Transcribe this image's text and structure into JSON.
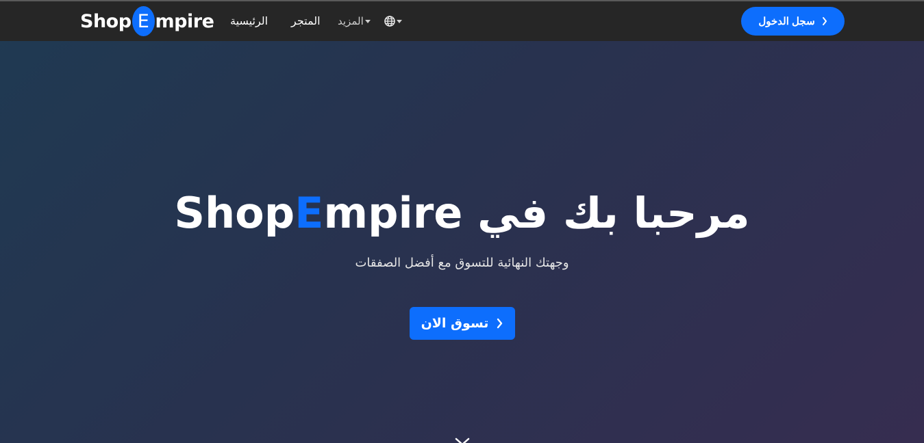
{
  "brand": {
    "part1": "Shop",
    "badge_letter": "E",
    "part2": "mpire"
  },
  "nav": {
    "home": "الرئيسية",
    "store": "المتجر",
    "more": "المزيد",
    "language_icon": "globe-icon"
  },
  "login_button": {
    "label": "سجل الدخول",
    "icon": "chevron-left-icon"
  },
  "hero": {
    "title_arabic": "مرحبا بك في",
    "title_brand_part1": "Shop",
    "title_brand_accent": "E",
    "title_brand_part2": "mpire",
    "subtitle": "وجهتك النهائية للتسوق مع أفضل الصفقات",
    "cta_label": "تسوق الان",
    "cta_icon": "chevron-left-icon",
    "scroll_icon": "chevron-down-icon"
  },
  "colors": {
    "accent": "#0d6efd",
    "navbar": "#262626",
    "text": "#ffffff"
  }
}
